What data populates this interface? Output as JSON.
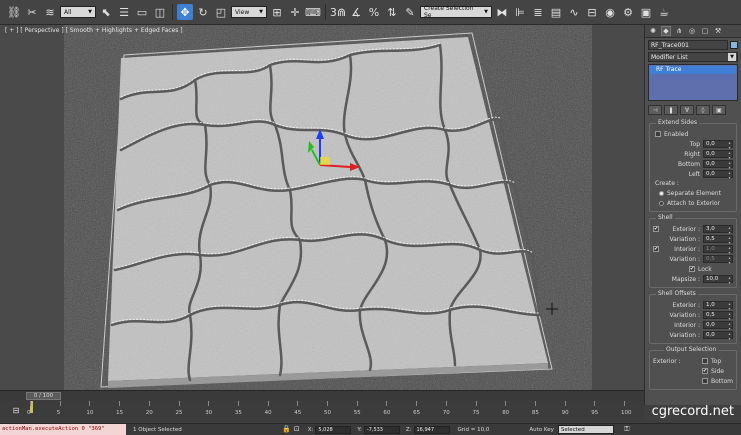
{
  "toolbar": {
    "selection_filter": "All",
    "reference_coord": "View",
    "named_selection": "Create Selection Se",
    "snap_angle_label": "3",
    "icons": [
      "link-icon",
      "unlink-icon",
      "bind-space-warp-icon",
      "select-object-icon",
      "select-by-name-icon",
      "rect-region-icon",
      "window-crossing-icon",
      "move-icon",
      "rotate-icon",
      "scale-icon",
      "pivot-center-icon",
      "manipulate-icon",
      "keyboard-shortcut-icon",
      "snaps-toggle-icon",
      "angle-snap-icon",
      "percent-snap-icon",
      "spinner-snap-icon",
      "edit-named-sel-icon",
      "mirror-icon",
      "align-icon",
      "layer-icon",
      "graphite-icon",
      "curve-editor-icon",
      "schematic-icon",
      "material-editor-icon",
      "render-setup-icon",
      "rendered-frame-icon",
      "render-icon"
    ]
  },
  "viewport": {
    "label": "[ + ] [ Perspective ] [ Smooth + Highlights + Edged Faces ]"
  },
  "panel": {
    "object_name": "RF_Trace001",
    "modifier_list": "Modifier List",
    "stack_item": "RF Trace",
    "extend_sides": {
      "title": "Extend Sides",
      "enabled": "Enabled",
      "top": "Top",
      "right": "Right",
      "bottom": "Bottom",
      "left": "Left",
      "top_val": "0,0",
      "right_val": "0,0",
      "bottom_val": "0,0",
      "left_val": "0,0",
      "create": "Create :",
      "separate": "Separate Element",
      "attach": "Attach to Exterior"
    },
    "shell": {
      "title": "Shell",
      "exterior": "Exterior :",
      "exterior_val": "3,0",
      "variation": "Variation :",
      "variation_val": "0,5",
      "interior": "Interior :",
      "interior_val": "1,0",
      "variation2": "Variation :",
      "variation2_val": "0,5",
      "lock": "Lock",
      "mapsize": "Mapsize :",
      "mapsize_val": "10,0"
    },
    "shell_offsets": {
      "title": "Shell Offsets",
      "exterior": "Exterior :",
      "exterior_val": "1,0",
      "variation": "Variation :",
      "variation_val": "0,5",
      "interior": "Interior :",
      "interior_val": "0,0",
      "variation2": "Variation :",
      "variation2_val": "0,0"
    },
    "output_selection": {
      "title": "Output Selection",
      "exterior": "Exterior :",
      "top": "Top",
      "side": "Side",
      "bottom": "Bottom"
    }
  },
  "timeline": {
    "frame": "0 / 100",
    "ticks": [
      "0",
      "5",
      "10",
      "15",
      "20",
      "25",
      "30",
      "35",
      "40",
      "45",
      "50",
      "55",
      "60",
      "65",
      "70",
      "75",
      "80",
      "85",
      "90",
      "95",
      "100"
    ]
  },
  "status": {
    "maxscript": "actionMan.executeAction 0 \"369\"",
    "selected_text": "1 Object Selected",
    "x_label": "X:",
    "x_val": "5,028",
    "y_label": "Y:",
    "y_val": "-7,533",
    "z_label": "Z:",
    "z_val": "16,947",
    "grid": "Grid = 10,0",
    "auto_key": "Auto Key",
    "selected_drop": "Selected"
  },
  "watermark": "cgrecord.net",
  "colors": {
    "accent": "#3d7fd0",
    "stack_bg": "#5e6fae",
    "object_color": "#86b7e0",
    "maxscript_bg": "#f4d5d5"
  }
}
